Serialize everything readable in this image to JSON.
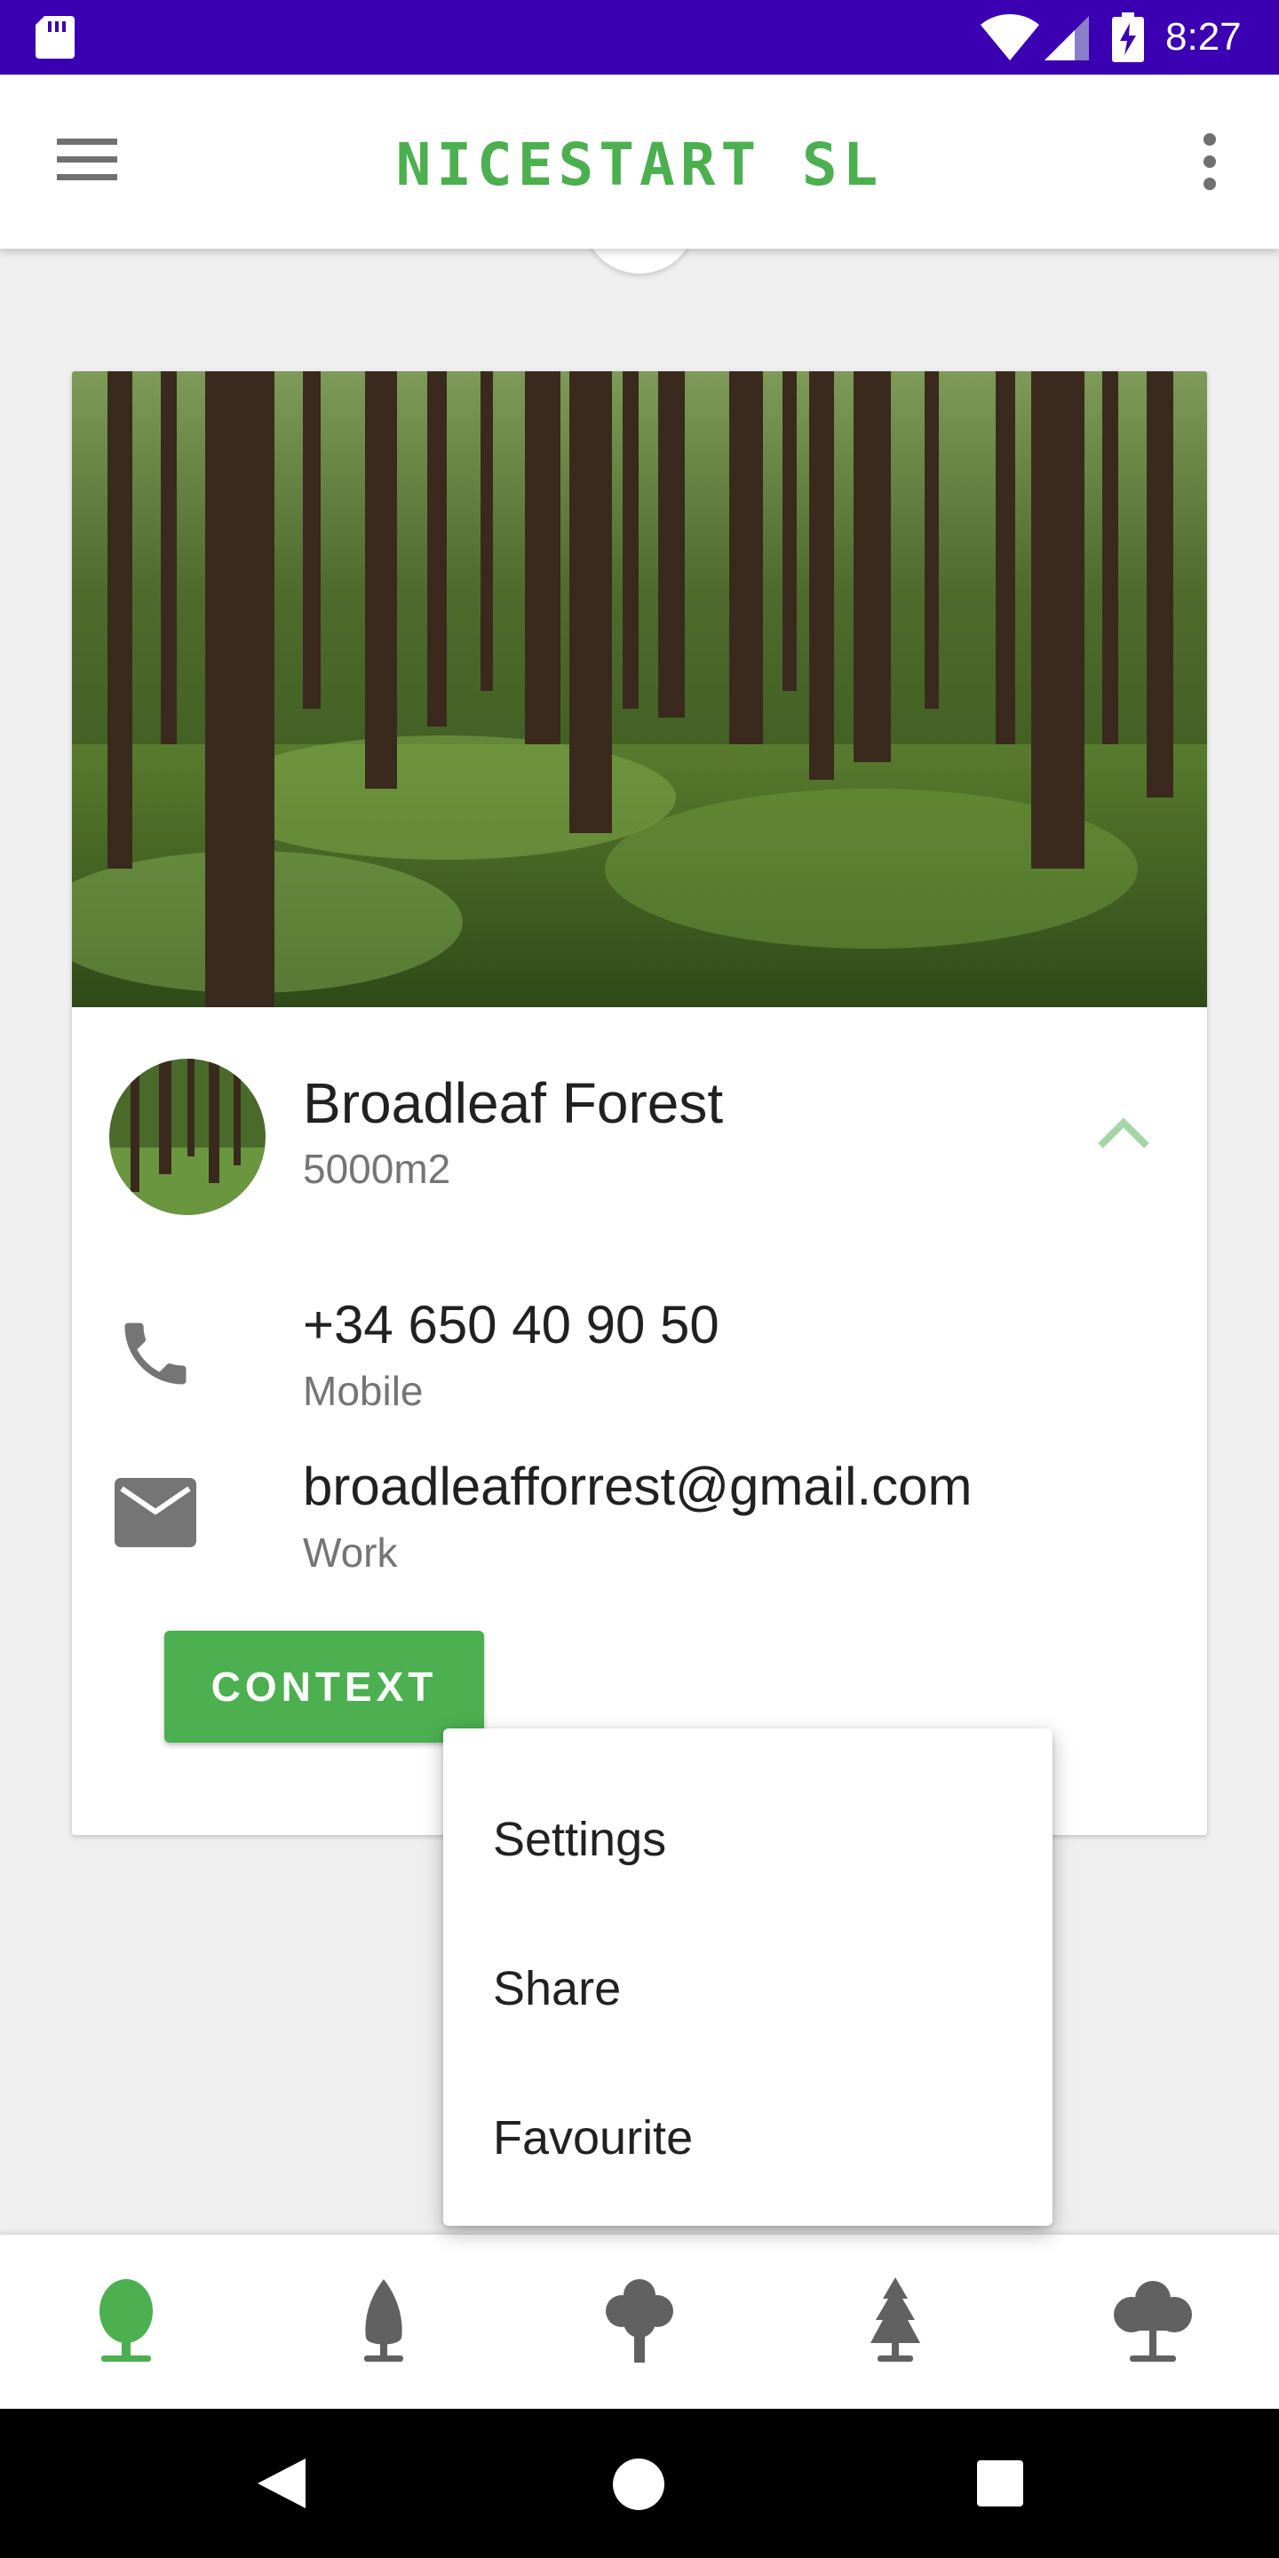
{
  "status_bar": {
    "time": "8:27",
    "icons": [
      "sd-card-icon",
      "wifi-icon",
      "cell-signal-icon",
      "battery-charging-icon"
    ],
    "background_color": "#3a00b2"
  },
  "app_bar": {
    "title": "NICESTART SL",
    "title_color": "#4caf50",
    "left_icon": "hamburger-menu-icon",
    "right_icon": "overflow-menu-icon"
  },
  "card": {
    "image_icon": "forest-photo",
    "title": "Broadleaf Forest",
    "subtitle": "5000m2",
    "expand_icon": "chevron-up-icon",
    "phone": {
      "value": "+34 650 40 90 50",
      "type": "Mobile",
      "icon": "phone-icon"
    },
    "email": {
      "value": "broadleafforrest@gmail.com",
      "type": "Work",
      "icon": "email-icon"
    },
    "context_button_label": "CONTEXT",
    "accent_color": "#4caf50"
  },
  "popup_menu": {
    "items": [
      {
        "label": "Settings"
      },
      {
        "label": "Share"
      },
      {
        "label": "Favourite"
      }
    ]
  },
  "bottom_nav": {
    "items": [
      {
        "icon": "tree-round-icon",
        "active": true
      },
      {
        "icon": "tree-poplar-icon",
        "active": false
      },
      {
        "icon": "tree-oak-icon",
        "active": false
      },
      {
        "icon": "tree-pine-icon",
        "active": false
      },
      {
        "icon": "tree-broad-icon",
        "active": false
      }
    ],
    "active_color": "#4caf50",
    "inactive_color": "#616161"
  },
  "system_nav": {
    "icons": [
      "back-icon",
      "home-icon",
      "recents-icon"
    ]
  }
}
